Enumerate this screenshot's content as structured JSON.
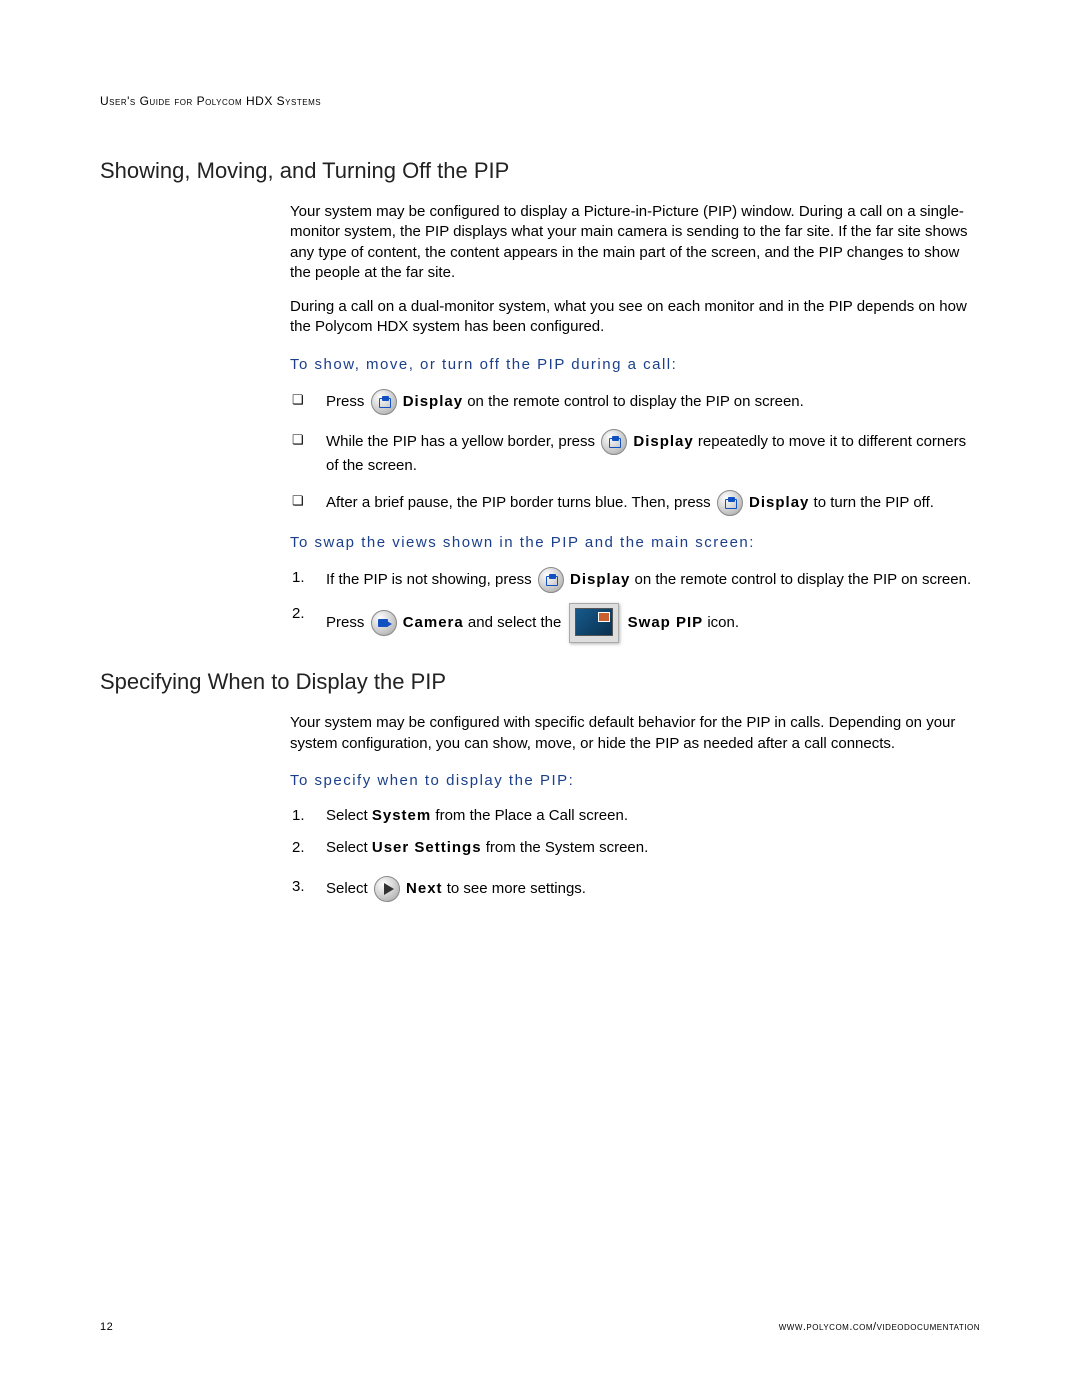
{
  "header": "User's Guide for Polycom HDX Systems",
  "section1": {
    "heading": "Showing, Moving, and Turning Off the PIP",
    "para1": "Your system may be configured to display a Picture-in-Picture (PIP) window. During a call on a single-monitor system, the PIP displays what your main camera is sending to the far site. If the far site shows any type of content, the content appears in the main part of the screen, and the PIP changes to show the people at the far site.",
    "para2": "During a call on a dual-monitor system, what you see on each monitor and in the PIP depends on how the Polycom HDX system has been configured.",
    "sub1": "To show, move, or turn off the PIP during a call:",
    "bullet1_a": "Press ",
    "bullet1_b": "Display",
    "bullet1_c": " on the remote control to display the PIP on screen.",
    "bullet2_a": "While the PIP has a yellow border, press ",
    "bullet2_b": "Display",
    "bullet2_c": " repeatedly to move it to different corners of the screen.",
    "bullet3_a": "After a brief pause, the PIP border turns blue. Then, press ",
    "bullet3_b": "Display",
    "bullet3_c": " to turn the PIP off.",
    "sub2": "To swap the views shown in the PIP and the main screen:",
    "num1_a": "If the PIP is not showing, press ",
    "num1_b": "Display",
    "num1_c": " on the remote control to display the PIP on screen.",
    "num2_a": "Press ",
    "num2_b": "Camera",
    "num2_c": " and select the ",
    "num2_d": "Swap PIP",
    "num2_e": " icon."
  },
  "section2": {
    "heading": "Specifying When to Display the PIP",
    "para1": "Your system may be configured with specific default behavior for the PIP in calls. Depending on your system configuration, you can show, move, or hide the PIP as needed after a call connects.",
    "sub1": "To specify when to display the PIP:",
    "step1_a": "Select ",
    "step1_b": "System",
    "step1_c": " from the Place a Call screen.",
    "step2_a": "Select ",
    "step2_b": "User Settings",
    "step2_c": " from the System screen.",
    "step3_a": "Select ",
    "step3_b": "Next",
    "step3_c": " to see more settings."
  },
  "footer": {
    "page": "12",
    "url": "www.polycom.com/videodocumentation"
  }
}
